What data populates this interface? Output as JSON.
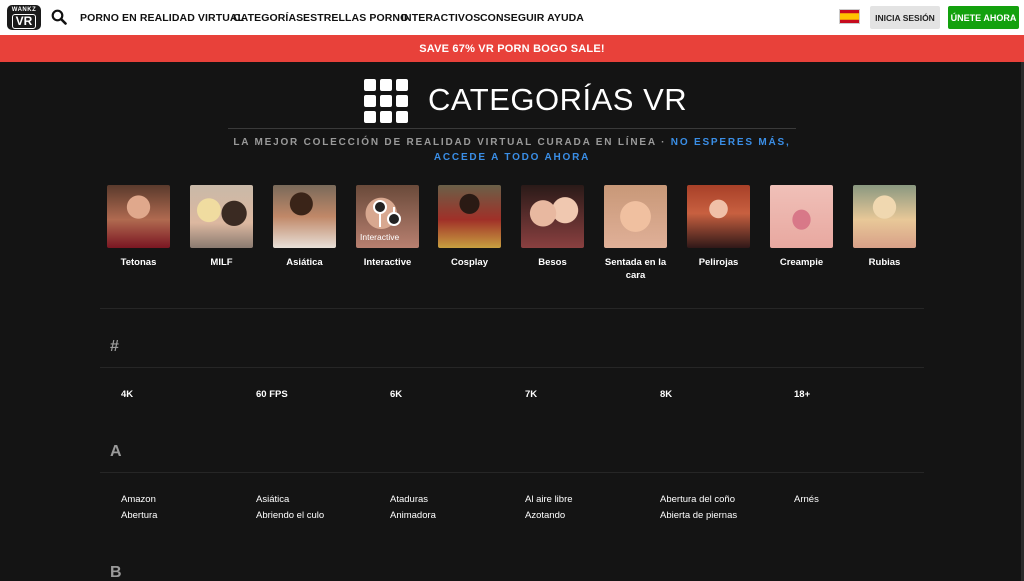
{
  "logo": {
    "line1": "WANKZ",
    "line2": "VR"
  },
  "nav": {
    "items": [
      "PORNO EN REALIDAD VIRTUAL",
      "CATEGORÍAS",
      "ESTRELLAS PORNO",
      "INTERACTIVOS",
      "CONSEGUIR AYUDA"
    ],
    "login_label": "INICIA SESIÓN",
    "join_label": "ÚNETE AHORA",
    "flag": "spain-flag-icon"
  },
  "promo": {
    "text": "SAVE 67% VR PORN BOGO SALE!"
  },
  "header": {
    "title": "CATEGORÍAS VR",
    "subtitle": "LA MEJOR COLECCIÓN DE REALIDAD VIRTUAL CURADA EN LÍNEA · ",
    "subtitle_cta": "NO ESPERES MÁS, ACCEDE A TODO AHORA"
  },
  "featured": [
    {
      "label": "Tetonas"
    },
    {
      "label": "MILF"
    },
    {
      "label": "Asiática"
    },
    {
      "label": "Interactive",
      "overlay": "Interactive"
    },
    {
      "label": "Cosplay"
    },
    {
      "label": "Besos"
    },
    {
      "label": "Sentada en la cara"
    },
    {
      "label": "Pelirojas"
    },
    {
      "label": "Creampie"
    },
    {
      "label": "Rubias"
    }
  ],
  "sections": [
    {
      "letter": "#",
      "rows": [
        [
          "4K",
          "60 FPS",
          "6K",
          "7K",
          "8K",
          "18+"
        ]
      ]
    },
    {
      "letter": "A",
      "rows": [
        [
          "Amazon",
          "Asiática",
          "Ataduras",
          "Al aire libre",
          "Abertura del coño",
          "Arnés"
        ],
        [
          "Abertura",
          "Abriendo el culo",
          "Animadora",
          "Azotando",
          "Abierta de piernas"
        ]
      ]
    },
    {
      "letter": "B",
      "rows": []
    }
  ],
  "colors": {
    "accent_red": "#e8413a",
    "join_green": "#13a10e",
    "link_blue": "#3a8ee6",
    "background": "#141414"
  }
}
